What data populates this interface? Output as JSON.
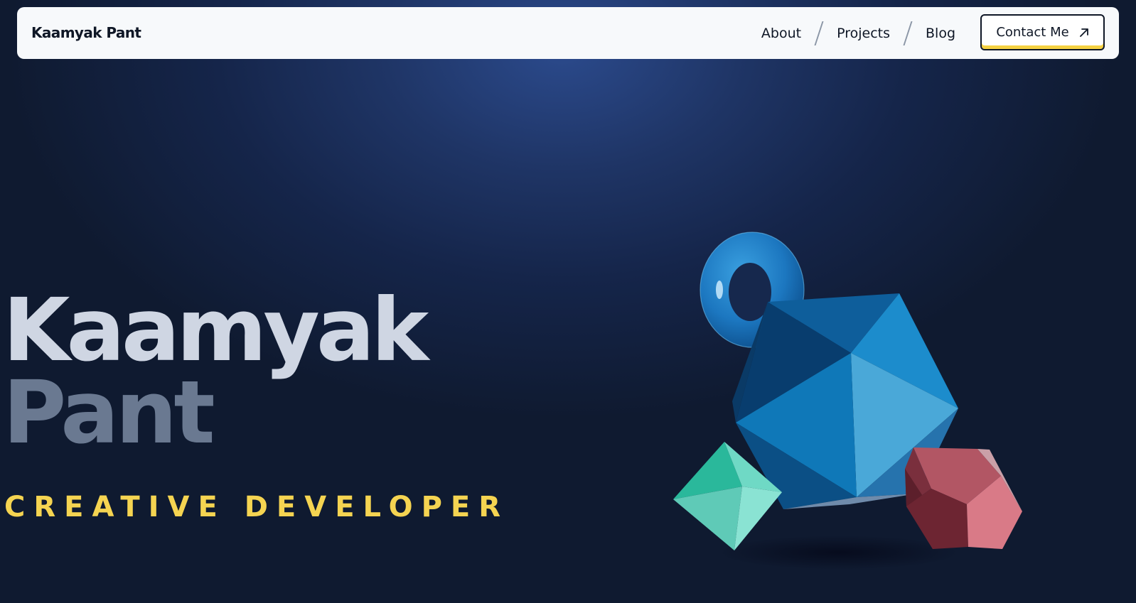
{
  "navbar": {
    "brand": "Kaamyak Pant",
    "links": [
      {
        "label": "About"
      },
      {
        "label": "Projects"
      },
      {
        "label": "Blog"
      }
    ],
    "contact_label": "Contact Me",
    "contact_icon": "arrow-up-right-icon"
  },
  "hero": {
    "first_name": "Kaamyak",
    "last_name": "Pant",
    "tagline": "CREATIVE DEVELOPER"
  },
  "art": {
    "shapes": [
      "torus",
      "icosahedron",
      "octahedron",
      "dodecahedron"
    ]
  },
  "colors": {
    "background": "#0f1a30",
    "navbar": "#f7f9fb",
    "accent_yellow": "#f5d142",
    "first_name": "#cfd6e3",
    "last_name": "#6a7991",
    "tagline": "#f5d451"
  }
}
